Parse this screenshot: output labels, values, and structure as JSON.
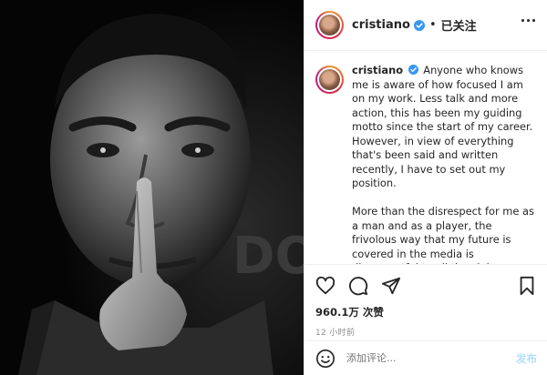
{
  "header": {
    "username": "cristiano",
    "separator": "•",
    "follow_status": "已关注"
  },
  "caption": {
    "username": "cristiano",
    "paragraph_1": "Anyone who knows me is aware of how focused I am on my work. Less talk and more action, this has been my guiding motto since the start of my career. However, in view of everything that's been said and written recently, I have to set out my position.",
    "paragraph_2": "More than the disrespect for me as a man and as a player, the frivolous way that my future is covered in the media is disrespectful to all the clubs involved in these rumours, as well as to their players and staff."
  },
  "actions": {
    "likes": "960.1万 次赞",
    "time": "12 小时前"
  },
  "comment": {
    "placeholder": "添加评论...",
    "post_label": "发布"
  },
  "colors": {
    "verified": "#3897f0",
    "post_button": "#b2dffc",
    "muted_text": "#8e8e8e"
  },
  "icons": [
    "verified-badge-icon",
    "more-options-icon",
    "heart-icon",
    "comment-icon",
    "share-icon",
    "bookmark-icon",
    "emoji-icon"
  ]
}
